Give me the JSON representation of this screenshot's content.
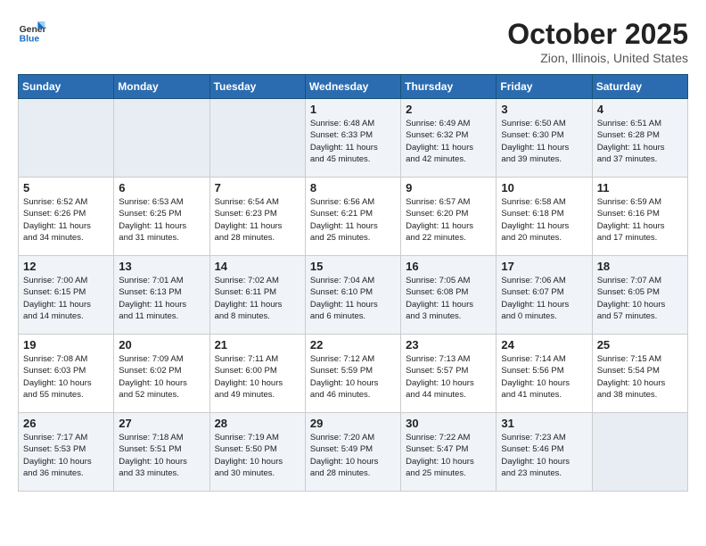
{
  "header": {
    "logo_line1": "General",
    "logo_line2": "Blue",
    "month": "October 2025",
    "location": "Zion, Illinois, United States"
  },
  "weekdays": [
    "Sunday",
    "Monday",
    "Tuesday",
    "Wednesday",
    "Thursday",
    "Friday",
    "Saturday"
  ],
  "weeks": [
    [
      {
        "day": "",
        "info": ""
      },
      {
        "day": "",
        "info": ""
      },
      {
        "day": "",
        "info": ""
      },
      {
        "day": "1",
        "info": "Sunrise: 6:48 AM\nSunset: 6:33 PM\nDaylight: 11 hours\nand 45 minutes."
      },
      {
        "day": "2",
        "info": "Sunrise: 6:49 AM\nSunset: 6:32 PM\nDaylight: 11 hours\nand 42 minutes."
      },
      {
        "day": "3",
        "info": "Sunrise: 6:50 AM\nSunset: 6:30 PM\nDaylight: 11 hours\nand 39 minutes."
      },
      {
        "day": "4",
        "info": "Sunrise: 6:51 AM\nSunset: 6:28 PM\nDaylight: 11 hours\nand 37 minutes."
      }
    ],
    [
      {
        "day": "5",
        "info": "Sunrise: 6:52 AM\nSunset: 6:26 PM\nDaylight: 11 hours\nand 34 minutes."
      },
      {
        "day": "6",
        "info": "Sunrise: 6:53 AM\nSunset: 6:25 PM\nDaylight: 11 hours\nand 31 minutes."
      },
      {
        "day": "7",
        "info": "Sunrise: 6:54 AM\nSunset: 6:23 PM\nDaylight: 11 hours\nand 28 minutes."
      },
      {
        "day": "8",
        "info": "Sunrise: 6:56 AM\nSunset: 6:21 PM\nDaylight: 11 hours\nand 25 minutes."
      },
      {
        "day": "9",
        "info": "Sunrise: 6:57 AM\nSunset: 6:20 PM\nDaylight: 11 hours\nand 22 minutes."
      },
      {
        "day": "10",
        "info": "Sunrise: 6:58 AM\nSunset: 6:18 PM\nDaylight: 11 hours\nand 20 minutes."
      },
      {
        "day": "11",
        "info": "Sunrise: 6:59 AM\nSunset: 6:16 PM\nDaylight: 11 hours\nand 17 minutes."
      }
    ],
    [
      {
        "day": "12",
        "info": "Sunrise: 7:00 AM\nSunset: 6:15 PM\nDaylight: 11 hours\nand 14 minutes."
      },
      {
        "day": "13",
        "info": "Sunrise: 7:01 AM\nSunset: 6:13 PM\nDaylight: 11 hours\nand 11 minutes."
      },
      {
        "day": "14",
        "info": "Sunrise: 7:02 AM\nSunset: 6:11 PM\nDaylight: 11 hours\nand 8 minutes."
      },
      {
        "day": "15",
        "info": "Sunrise: 7:04 AM\nSunset: 6:10 PM\nDaylight: 11 hours\nand 6 minutes."
      },
      {
        "day": "16",
        "info": "Sunrise: 7:05 AM\nSunset: 6:08 PM\nDaylight: 11 hours\nand 3 minutes."
      },
      {
        "day": "17",
        "info": "Sunrise: 7:06 AM\nSunset: 6:07 PM\nDaylight: 11 hours\nand 0 minutes."
      },
      {
        "day": "18",
        "info": "Sunrise: 7:07 AM\nSunset: 6:05 PM\nDaylight: 10 hours\nand 57 minutes."
      }
    ],
    [
      {
        "day": "19",
        "info": "Sunrise: 7:08 AM\nSunset: 6:03 PM\nDaylight: 10 hours\nand 55 minutes."
      },
      {
        "day": "20",
        "info": "Sunrise: 7:09 AM\nSunset: 6:02 PM\nDaylight: 10 hours\nand 52 minutes."
      },
      {
        "day": "21",
        "info": "Sunrise: 7:11 AM\nSunset: 6:00 PM\nDaylight: 10 hours\nand 49 minutes."
      },
      {
        "day": "22",
        "info": "Sunrise: 7:12 AM\nSunset: 5:59 PM\nDaylight: 10 hours\nand 46 minutes."
      },
      {
        "day": "23",
        "info": "Sunrise: 7:13 AM\nSunset: 5:57 PM\nDaylight: 10 hours\nand 44 minutes."
      },
      {
        "day": "24",
        "info": "Sunrise: 7:14 AM\nSunset: 5:56 PM\nDaylight: 10 hours\nand 41 minutes."
      },
      {
        "day": "25",
        "info": "Sunrise: 7:15 AM\nSunset: 5:54 PM\nDaylight: 10 hours\nand 38 minutes."
      }
    ],
    [
      {
        "day": "26",
        "info": "Sunrise: 7:17 AM\nSunset: 5:53 PM\nDaylight: 10 hours\nand 36 minutes."
      },
      {
        "day": "27",
        "info": "Sunrise: 7:18 AM\nSunset: 5:51 PM\nDaylight: 10 hours\nand 33 minutes."
      },
      {
        "day": "28",
        "info": "Sunrise: 7:19 AM\nSunset: 5:50 PM\nDaylight: 10 hours\nand 30 minutes."
      },
      {
        "day": "29",
        "info": "Sunrise: 7:20 AM\nSunset: 5:49 PM\nDaylight: 10 hours\nand 28 minutes."
      },
      {
        "day": "30",
        "info": "Sunrise: 7:22 AM\nSunset: 5:47 PM\nDaylight: 10 hours\nand 25 minutes."
      },
      {
        "day": "31",
        "info": "Sunrise: 7:23 AM\nSunset: 5:46 PM\nDaylight: 10 hours\nand 23 minutes."
      },
      {
        "day": "",
        "info": ""
      }
    ]
  ]
}
